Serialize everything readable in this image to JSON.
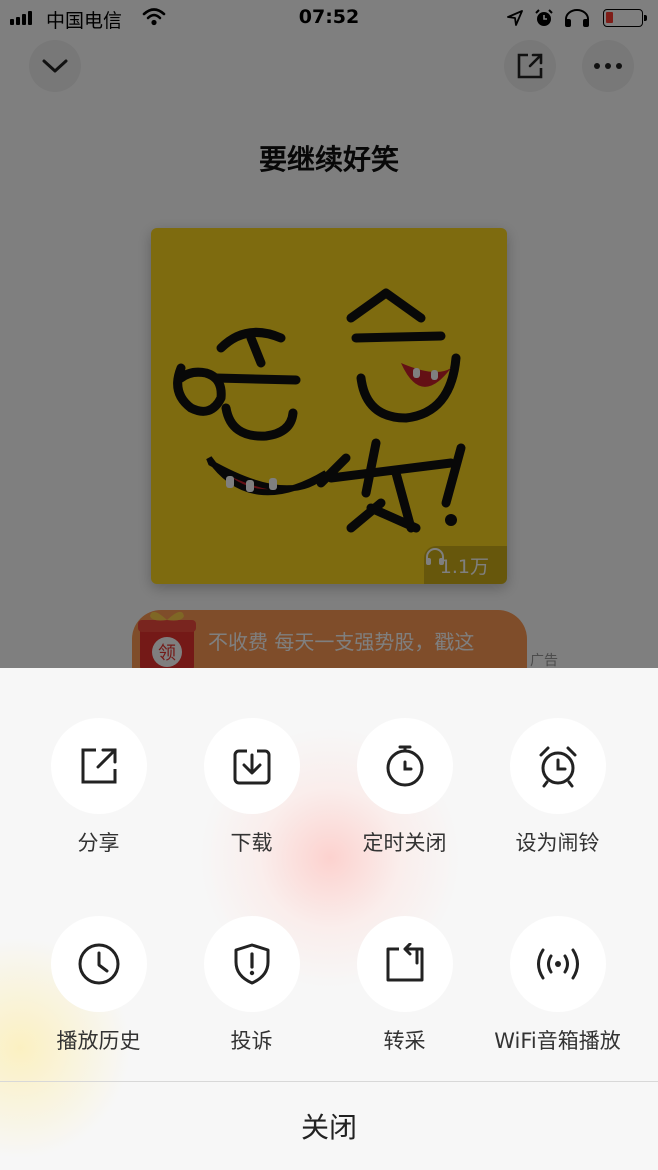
{
  "status_bar": {
    "carrier": "中国电信",
    "time": "07:52"
  },
  "player": {
    "title": "要继续好笑",
    "play_count": "1.1万"
  },
  "ad": {
    "gift_label": "领",
    "text": "不收费 每天一支强势股，戳这",
    "tag": "广告"
  },
  "action_sheet": {
    "actions": [
      {
        "label": "分享",
        "icon": "share-icon"
      },
      {
        "label": "下载",
        "icon": "download-icon"
      },
      {
        "label": "定时关闭",
        "icon": "timer-icon"
      },
      {
        "label": "设为闹铃",
        "icon": "alarm-clock-icon"
      },
      {
        "label": "播放历史",
        "icon": "history-clock-icon"
      },
      {
        "label": "投诉",
        "icon": "report-shield-icon"
      },
      {
        "label": "转采",
        "icon": "repost-icon"
      },
      {
        "label": "WiFi音箱播放",
        "icon": "wifi-speaker-icon"
      }
    ],
    "close_label": "关闭"
  },
  "colors": {
    "cover_background": "#fcd61e",
    "ad_background": "#ff9a54",
    "sheet_background": "#f7f7f7",
    "battery_low": "#ff3b30"
  }
}
